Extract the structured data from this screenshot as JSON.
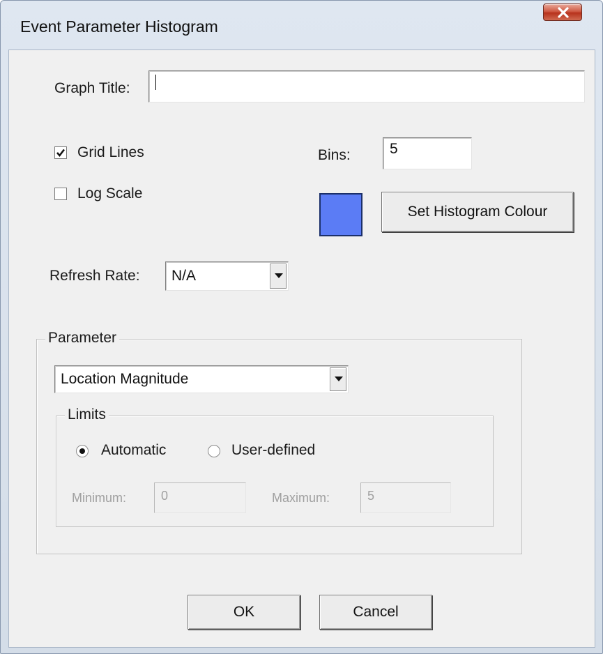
{
  "window": {
    "title": "Event Parameter Histogram"
  },
  "graph_title": {
    "label": "Graph Title:",
    "value": ""
  },
  "grid_lines": {
    "label": "Grid Lines",
    "checked": true
  },
  "log_scale": {
    "label": "Log Scale",
    "checked": false
  },
  "bins": {
    "label": "Bins:",
    "value": "5"
  },
  "histogram_colour": {
    "color": "#5b7cf5",
    "button_label": "Set Histogram Colour"
  },
  "refresh_rate": {
    "label": "Refresh Rate:",
    "value": "N/A"
  },
  "parameter": {
    "group_label": "Parameter",
    "selected": "Location Magnitude",
    "limits": {
      "group_label": "Limits",
      "automatic_label": "Automatic",
      "user_defined_label": "User-defined",
      "mode": "automatic",
      "minimum_label": "Minimum:",
      "minimum_value": "0",
      "maximum_label": "Maximum:",
      "maximum_value": "5"
    }
  },
  "buttons": {
    "ok": "OK",
    "cancel": "Cancel"
  }
}
